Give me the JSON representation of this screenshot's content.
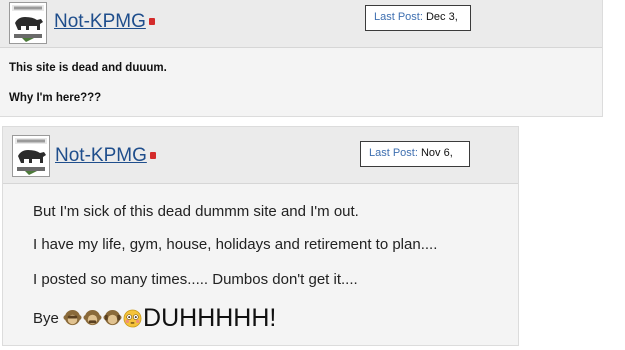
{
  "posts": [
    {
      "username": "Not-KPMG",
      "last_post_label": "Last Post:",
      "last_post_value": "Dec 3,",
      "lines": [
        "This site is dead and duuum.",
        "Why I'm here???"
      ]
    },
    {
      "username": "Not-KPMG",
      "last_post_label": "Last Post:",
      "last_post_value": "Nov 6,",
      "lines": [
        "But I'm sick of this dead dummm site and I'm out.",
        "I have my life, gym, house, holidays and retirement to plan....",
        "I posted so many times..... Dumbos don't get it...."
      ],
      "bye": "Bye",
      "duh": "DUHHHHH!"
    }
  ],
  "icons": [
    "avatar-bear-icon",
    "online-status-icon",
    "monkey-emoji-icon",
    "flushed-face-emoji-icon"
  ],
  "colors": {
    "username": "#1f4e8c",
    "last_post_label": "#3e6fb0",
    "status": "#d42b2b",
    "header_bg": "#ebebeb",
    "post_bg": "#f4f4f4"
  }
}
